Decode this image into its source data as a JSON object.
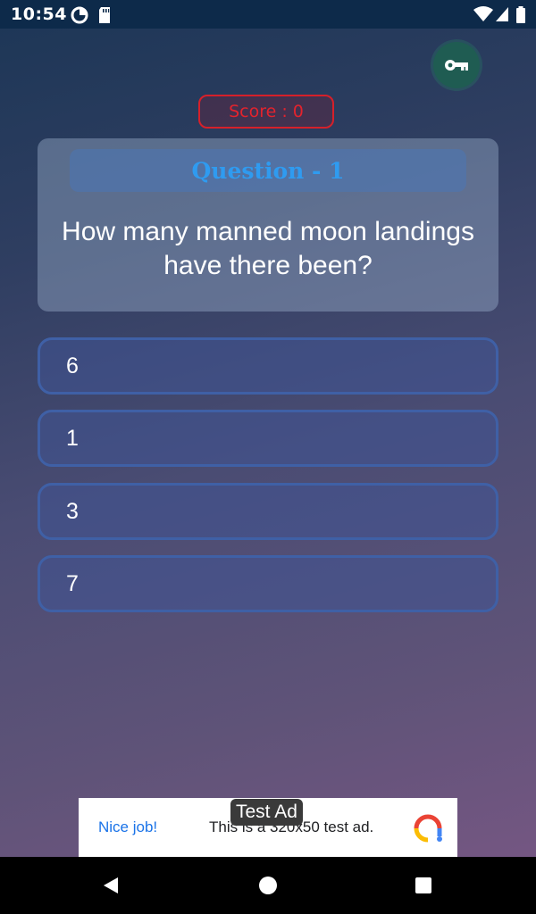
{
  "status_bar": {
    "time": "10:54",
    "icons": [
      "data-saver-icon",
      "sd-card-icon",
      "wifi-icon",
      "signal-icon",
      "battery-icon"
    ]
  },
  "toolbar": {
    "key_icon": "key-icon"
  },
  "score": {
    "label": "Score : 0"
  },
  "question": {
    "header": "Question - 1",
    "text": "How many manned moon landings have there been?"
  },
  "options": [
    {
      "label": "6"
    },
    {
      "label": "1"
    },
    {
      "label": "3"
    },
    {
      "label": "7"
    }
  ],
  "ad": {
    "tag": "Test Ad",
    "headline": "Nice job!",
    "body": "This is a 320x50 test ad."
  },
  "nav": {
    "icons": [
      "back-icon",
      "home-icon",
      "recents-icon"
    ]
  },
  "colors": {
    "score_red": "#e3232d",
    "question_header_blue": "#2f9bf0",
    "option_border": "#3f60a6",
    "status_bar": "#0d2a4a"
  }
}
